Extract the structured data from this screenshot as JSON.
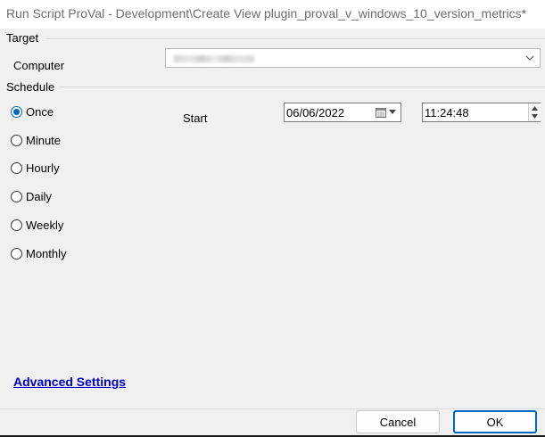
{
  "window": {
    "title": "Run Script ProVal - Development\\Create View plugin_proval_v_windows_10_version_metrics*"
  },
  "target": {
    "section_label": "Target",
    "computer_label": "Computer",
    "computer_value": ""
  },
  "schedule": {
    "section_label": "Schedule",
    "options": [
      "Once",
      "Minute",
      "Hourly",
      "Daily",
      "Weekly",
      "Monthly"
    ],
    "selected": "Once",
    "start_label": "Start",
    "date_value": "06/06/2022",
    "time_value": "11:24:48"
  },
  "links": {
    "advanced_settings": "Advanced Settings"
  },
  "buttons": {
    "cancel": "Cancel",
    "ok": "OK"
  },
  "colors": {
    "accent": "#0067c0",
    "link": "#0000cc",
    "background": "#f0f0f0"
  }
}
